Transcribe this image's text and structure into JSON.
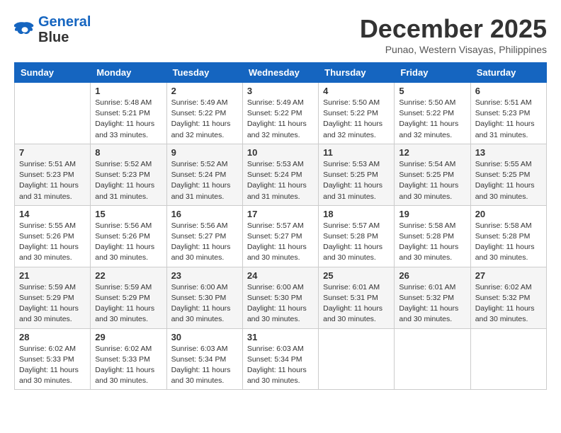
{
  "header": {
    "logo_general": "General",
    "logo_blue": "Blue",
    "month_title": "December 2025",
    "location": "Punao, Western Visayas, Philippines"
  },
  "days_of_week": [
    "Sunday",
    "Monday",
    "Tuesday",
    "Wednesday",
    "Thursday",
    "Friday",
    "Saturday"
  ],
  "weeks": [
    [
      {
        "day": "",
        "sunrise": "",
        "sunset": "",
        "daylight": ""
      },
      {
        "day": "1",
        "sunrise": "Sunrise: 5:48 AM",
        "sunset": "Sunset: 5:21 PM",
        "daylight": "Daylight: 11 hours and 33 minutes."
      },
      {
        "day": "2",
        "sunrise": "Sunrise: 5:49 AM",
        "sunset": "Sunset: 5:22 PM",
        "daylight": "Daylight: 11 hours and 32 minutes."
      },
      {
        "day": "3",
        "sunrise": "Sunrise: 5:49 AM",
        "sunset": "Sunset: 5:22 PM",
        "daylight": "Daylight: 11 hours and 32 minutes."
      },
      {
        "day": "4",
        "sunrise": "Sunrise: 5:50 AM",
        "sunset": "Sunset: 5:22 PM",
        "daylight": "Daylight: 11 hours and 32 minutes."
      },
      {
        "day": "5",
        "sunrise": "Sunrise: 5:50 AM",
        "sunset": "Sunset: 5:22 PM",
        "daylight": "Daylight: 11 hours and 32 minutes."
      },
      {
        "day": "6",
        "sunrise": "Sunrise: 5:51 AM",
        "sunset": "Sunset: 5:23 PM",
        "daylight": "Daylight: 11 hours and 31 minutes."
      }
    ],
    [
      {
        "day": "7",
        "sunrise": "Sunrise: 5:51 AM",
        "sunset": "Sunset: 5:23 PM",
        "daylight": "Daylight: 11 hours and 31 minutes."
      },
      {
        "day": "8",
        "sunrise": "Sunrise: 5:52 AM",
        "sunset": "Sunset: 5:23 PM",
        "daylight": "Daylight: 11 hours and 31 minutes."
      },
      {
        "day": "9",
        "sunrise": "Sunrise: 5:52 AM",
        "sunset": "Sunset: 5:24 PM",
        "daylight": "Daylight: 11 hours and 31 minutes."
      },
      {
        "day": "10",
        "sunrise": "Sunrise: 5:53 AM",
        "sunset": "Sunset: 5:24 PM",
        "daylight": "Daylight: 11 hours and 31 minutes."
      },
      {
        "day": "11",
        "sunrise": "Sunrise: 5:53 AM",
        "sunset": "Sunset: 5:25 PM",
        "daylight": "Daylight: 11 hours and 31 minutes."
      },
      {
        "day": "12",
        "sunrise": "Sunrise: 5:54 AM",
        "sunset": "Sunset: 5:25 PM",
        "daylight": "Daylight: 11 hours and 30 minutes."
      },
      {
        "day": "13",
        "sunrise": "Sunrise: 5:55 AM",
        "sunset": "Sunset: 5:25 PM",
        "daylight": "Daylight: 11 hours and 30 minutes."
      }
    ],
    [
      {
        "day": "14",
        "sunrise": "Sunrise: 5:55 AM",
        "sunset": "Sunset: 5:26 PM",
        "daylight": "Daylight: 11 hours and 30 minutes."
      },
      {
        "day": "15",
        "sunrise": "Sunrise: 5:56 AM",
        "sunset": "Sunset: 5:26 PM",
        "daylight": "Daylight: 11 hours and 30 minutes."
      },
      {
        "day": "16",
        "sunrise": "Sunrise: 5:56 AM",
        "sunset": "Sunset: 5:27 PM",
        "daylight": "Daylight: 11 hours and 30 minutes."
      },
      {
        "day": "17",
        "sunrise": "Sunrise: 5:57 AM",
        "sunset": "Sunset: 5:27 PM",
        "daylight": "Daylight: 11 hours and 30 minutes."
      },
      {
        "day": "18",
        "sunrise": "Sunrise: 5:57 AM",
        "sunset": "Sunset: 5:28 PM",
        "daylight": "Daylight: 11 hours and 30 minutes."
      },
      {
        "day": "19",
        "sunrise": "Sunrise: 5:58 AM",
        "sunset": "Sunset: 5:28 PM",
        "daylight": "Daylight: 11 hours and 30 minutes."
      },
      {
        "day": "20",
        "sunrise": "Sunrise: 5:58 AM",
        "sunset": "Sunset: 5:28 PM",
        "daylight": "Daylight: 11 hours and 30 minutes."
      }
    ],
    [
      {
        "day": "21",
        "sunrise": "Sunrise: 5:59 AM",
        "sunset": "Sunset: 5:29 PM",
        "daylight": "Daylight: 11 hours and 30 minutes."
      },
      {
        "day": "22",
        "sunrise": "Sunrise: 5:59 AM",
        "sunset": "Sunset: 5:29 PM",
        "daylight": "Daylight: 11 hours and 30 minutes."
      },
      {
        "day": "23",
        "sunrise": "Sunrise: 6:00 AM",
        "sunset": "Sunset: 5:30 PM",
        "daylight": "Daylight: 11 hours and 30 minutes."
      },
      {
        "day": "24",
        "sunrise": "Sunrise: 6:00 AM",
        "sunset": "Sunset: 5:30 PM",
        "daylight": "Daylight: 11 hours and 30 minutes."
      },
      {
        "day": "25",
        "sunrise": "Sunrise: 6:01 AM",
        "sunset": "Sunset: 5:31 PM",
        "daylight": "Daylight: 11 hours and 30 minutes."
      },
      {
        "day": "26",
        "sunrise": "Sunrise: 6:01 AM",
        "sunset": "Sunset: 5:32 PM",
        "daylight": "Daylight: 11 hours and 30 minutes."
      },
      {
        "day": "27",
        "sunrise": "Sunrise: 6:02 AM",
        "sunset": "Sunset: 5:32 PM",
        "daylight": "Daylight: 11 hours and 30 minutes."
      }
    ],
    [
      {
        "day": "28",
        "sunrise": "Sunrise: 6:02 AM",
        "sunset": "Sunset: 5:33 PM",
        "daylight": "Daylight: 11 hours and 30 minutes."
      },
      {
        "day": "29",
        "sunrise": "Sunrise: 6:02 AM",
        "sunset": "Sunset: 5:33 PM",
        "daylight": "Daylight: 11 hours and 30 minutes."
      },
      {
        "day": "30",
        "sunrise": "Sunrise: 6:03 AM",
        "sunset": "Sunset: 5:34 PM",
        "daylight": "Daylight: 11 hours and 30 minutes."
      },
      {
        "day": "31",
        "sunrise": "Sunrise: 6:03 AM",
        "sunset": "Sunset: 5:34 PM",
        "daylight": "Daylight: 11 hours and 30 minutes."
      },
      {
        "day": "",
        "sunrise": "",
        "sunset": "",
        "daylight": ""
      },
      {
        "day": "",
        "sunrise": "",
        "sunset": "",
        "daylight": ""
      },
      {
        "day": "",
        "sunrise": "",
        "sunset": "",
        "daylight": ""
      }
    ]
  ]
}
